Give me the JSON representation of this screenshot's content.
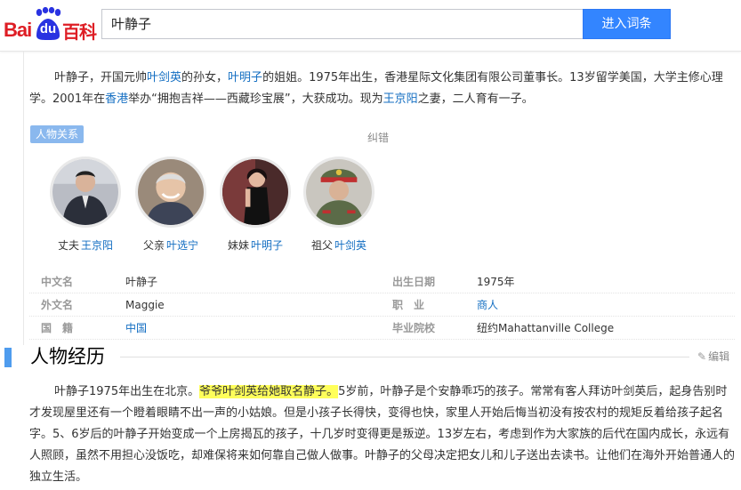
{
  "header": {
    "logo_bai": "Bai",
    "logo_du": "du",
    "logo_baike": "百科",
    "search_value": "叶静子",
    "search_button": "进入词条"
  },
  "summary": {
    "p1": "叶静子，开国元帅",
    "l1": "叶剑英",
    "p2": "的孙女，",
    "l2": "叶明子",
    "p3": "的姐姐。1975年出生，香港星际文化集团有限公司董事长。13岁留学美国，大学主修心理学。2001年在",
    "l3": "香港",
    "p4": "举办“拥抱吉祥——西藏珍宝展”，大获成功。现为",
    "l4": "王京阳",
    "p5": "之妻，二人育有一子。"
  },
  "relations": {
    "tag": "人物关系",
    "correct": "纠错",
    "people": [
      {
        "role": "丈夫",
        "name": "王京阳"
      },
      {
        "role": "父亲",
        "name": "叶选宁"
      },
      {
        "role": "妹妹",
        "name": "叶明子"
      },
      {
        "role": "祖父",
        "name": "叶剑英"
      }
    ]
  },
  "info": {
    "rows": [
      {
        "k1": "中文名",
        "v1": "叶静子",
        "k2": "出生日期",
        "v2": "1975年"
      },
      {
        "k1": "外文名",
        "v1": "Maggie",
        "k2": "职　业",
        "v2": "商人"
      },
      {
        "k1": "国　籍",
        "v1": "中国",
        "k2": "毕业院校",
        "v2": "纽约Mahattanville College"
      }
    ]
  },
  "section": {
    "title": "人物经历",
    "edit": "编辑"
  },
  "body": {
    "t1": "叶静子1975年出生在北京。",
    "h1": "爷爷叶剑英给她取名静子。",
    "t2": "5岁前，叶静子是个安静乖巧的孩子。常常有客人拜访叶剑英后，起身告别时才发现屋里还有一个瞪着眼睛不出一声的小姑娘。但是小孩子长得快，变得也快，家里人开始后悔当初没有按农村的规矩反着给孩子起名字。5、6岁后的叶静子开始变成一个上房揭瓦的孩子，十几岁时变得更是叛逆。13岁左右，考虑到作为大家族的后代在国内成长，永远有人照顾，虽然不用担心没饭吃，却难保将来如何靠自己做人做事。叶静子的父母决定把女儿和儿子送出去读书。让他们在海外开始普通人的独立生活。"
  }
}
